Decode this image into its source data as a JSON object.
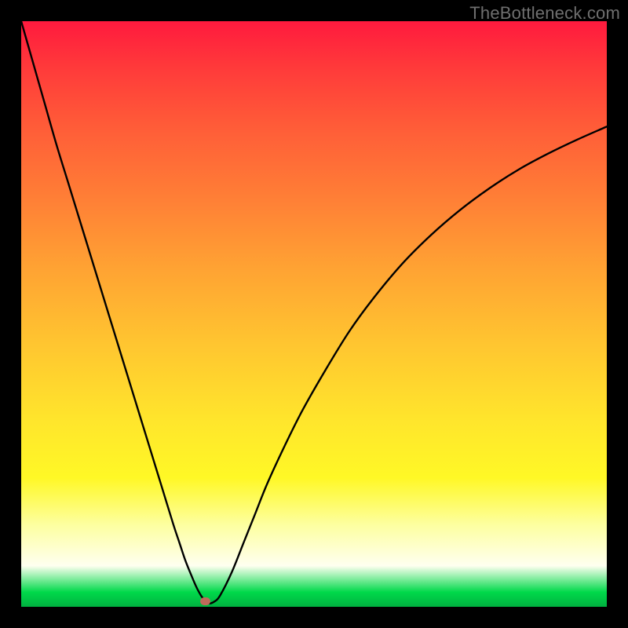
{
  "watermark": "TheBottleneck.com",
  "marker": {
    "x_pct": 31.5,
    "y_pct": 99.0
  },
  "chart_data": {
    "type": "line",
    "title": "",
    "xlabel": "",
    "ylabel": "",
    "xlim": [
      0,
      100
    ],
    "ylim": [
      0,
      100
    ],
    "grid": false,
    "legend": false,
    "series": [
      {
        "name": "bottleneck-curve",
        "x": [
          0,
          2,
          4,
          6,
          8,
          10,
          12,
          14,
          16,
          18,
          20,
          22,
          24,
          26,
          27,
          28,
          29,
          30,
          31,
          32,
          33,
          34,
          36,
          38,
          40,
          42,
          45,
          48,
          52,
          56,
          60,
          65,
          70,
          75,
          80,
          85,
          90,
          95,
          100
        ],
        "y": [
          100,
          93,
          86,
          79,
          72.5,
          66,
          59.5,
          53,
          46.5,
          40,
          33.5,
          27,
          20.5,
          14,
          11,
          8,
          5.5,
          3.2,
          1.5,
          0.6,
          0.9,
          2.0,
          6.0,
          11,
          16,
          21,
          27.5,
          33.5,
          40.5,
          47,
          52.5,
          58.5,
          63.5,
          67.8,
          71.5,
          74.7,
          77.4,
          79.8,
          82
        ]
      }
    ],
    "marker_point": {
      "x": 31.5,
      "y": 1.0
    },
    "gradient_stops": [
      {
        "pct": 0,
        "color": "#ff1a3e"
      },
      {
        "pct": 8,
        "color": "#ff3a3a"
      },
      {
        "pct": 18,
        "color": "#ff5c38"
      },
      {
        "pct": 30,
        "color": "#ff7e36"
      },
      {
        "pct": 42,
        "color": "#ffa233"
      },
      {
        "pct": 55,
        "color": "#ffc530"
      },
      {
        "pct": 68,
        "color": "#ffe52c"
      },
      {
        "pct": 78,
        "color": "#fff826"
      },
      {
        "pct": 86,
        "color": "#fdffa0"
      },
      {
        "pct": 93,
        "color": "#fefff0"
      },
      {
        "pct": 97.5,
        "color": "#00d94a"
      },
      {
        "pct": 100,
        "color": "#00b140"
      }
    ]
  }
}
